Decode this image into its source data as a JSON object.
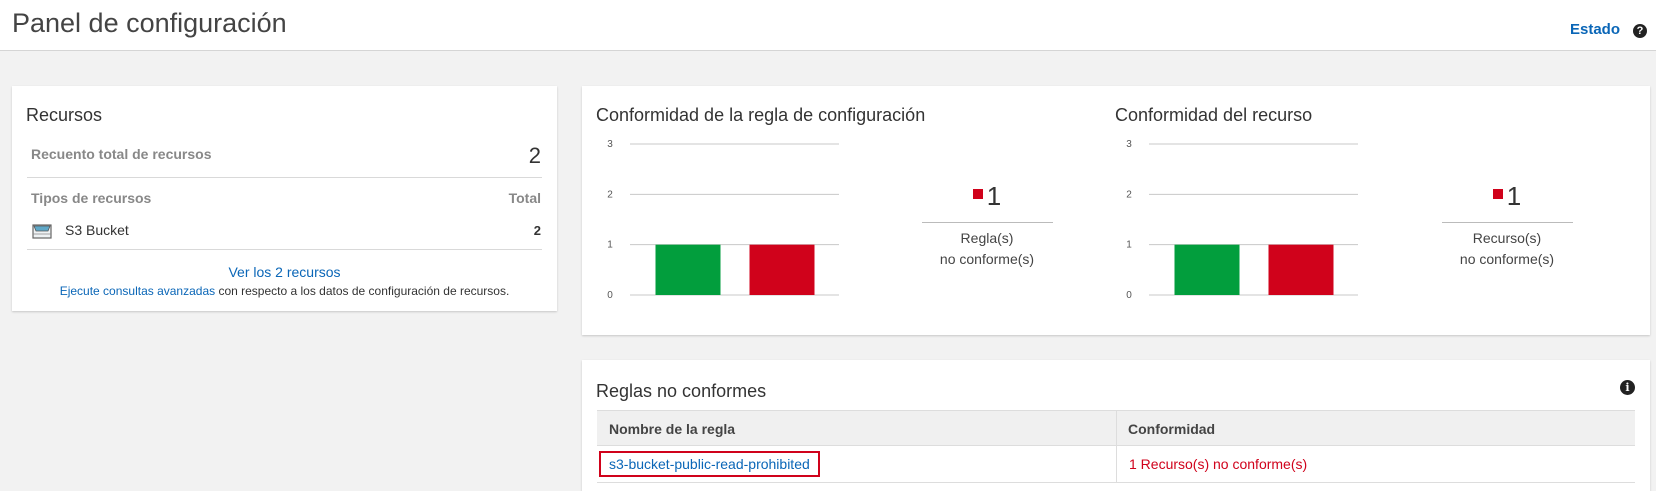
{
  "header": {
    "title": "Panel de configuración",
    "status_link": "Estado",
    "help_icon": "question-circle-icon"
  },
  "resources": {
    "title": "Recursos",
    "total_label": "Recuento total de recursos",
    "total_value": "2",
    "types_label": "Tipos de recursos",
    "total_col_label": "Total",
    "items": [
      {
        "icon": "s3-bucket-icon",
        "name": "S3 Bucket",
        "count": "2"
      }
    ],
    "view_all": "Ver los 2 recursos",
    "advanced_link": "Ejecute consultas avanzadas",
    "advanced_text": " con respecto a los datos de configuración de recursos."
  },
  "rule_compliance": {
    "title": "Conformidad de la regla de configuración",
    "count": "1",
    "label_line1": "Regla(s)",
    "label_line2": "no conforme(s)"
  },
  "resource_compliance": {
    "title": "Conformidad del recurso",
    "count": "1",
    "label_line1": "Recurso(s)",
    "label_line2": "no conforme(s)"
  },
  "noncompliant_rules": {
    "title": "Reglas no conformes",
    "info_icon": "info-circle-icon",
    "col_name": "Nombre de la regla",
    "col_compliance": "Conformidad",
    "rows": [
      {
        "name": "s3-bucket-public-read-prohibited",
        "compliance": "1 Recurso(s) no conforme(s)"
      }
    ]
  },
  "colors": {
    "compliant": "#029e3d",
    "noncompliant": "#d0021b",
    "link": "#0a66b7"
  },
  "chart_data": [
    {
      "type": "bar",
      "title": "Conformidad de la regla de configuración",
      "categories": [
        "",
        ""
      ],
      "values": [
        1,
        1
      ],
      "colors": [
        "#029e3d",
        "#d0021b"
      ],
      "yticks": [
        "0",
        "1",
        "2",
        "3"
      ],
      "ylim": [
        0,
        3
      ],
      "grid": true
    },
    {
      "type": "bar",
      "title": "Conformidad del recurso",
      "categories": [
        "",
        ""
      ],
      "values": [
        1,
        1
      ],
      "colors": [
        "#029e3d",
        "#d0021b"
      ],
      "yticks": [
        "0",
        "1",
        "2",
        "3"
      ],
      "ylim": [
        0,
        3
      ],
      "grid": true
    }
  ]
}
